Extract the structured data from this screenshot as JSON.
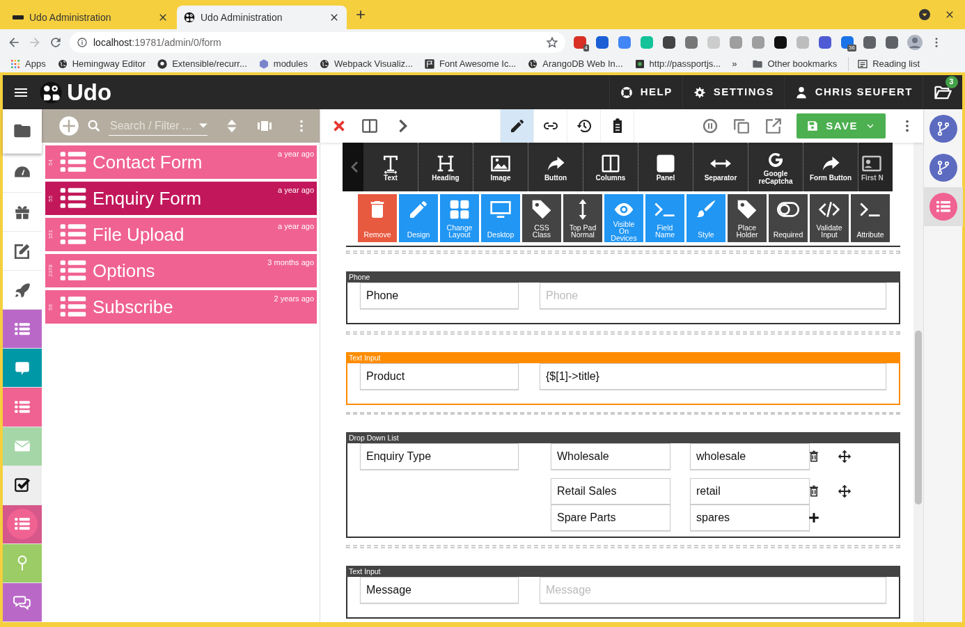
{
  "browser": {
    "tabs": [
      {
        "title": "Udo Administration",
        "selected": false
      },
      {
        "title": "Udo Administration",
        "selected": true
      }
    ],
    "address": {
      "host": "localhost",
      "path": ":19781/admin/0/form"
    },
    "extensions": [
      {
        "color": "#d93025",
        "badge": "4"
      },
      {
        "color": "#1a5fd6"
      },
      {
        "color": "#4285f4"
      },
      {
        "color": "#15c39a"
      },
      {
        "color": "#444444"
      },
      {
        "color": "#777777"
      },
      {
        "color": "#cccccc"
      },
      {
        "color": "#9e9e9e"
      },
      {
        "color": "#9e9e9e"
      },
      {
        "color": "#111111"
      },
      {
        "color": "#bdbdbd"
      },
      {
        "color": "#4f5bd5"
      },
      {
        "color": "#1a73e8",
        "badge": "36"
      },
      {
        "color": "#5f6368"
      },
      {
        "color": "#5f6368"
      }
    ],
    "bookmarks": [
      {
        "label": "Apps"
      },
      {
        "label": "Hemingway Editor"
      },
      {
        "label": "Extensible/recurr..."
      },
      {
        "label": "modules"
      },
      {
        "label": "Webpack Visualiz..."
      },
      {
        "label": "Font Awesome Ic..."
      },
      {
        "label": "ArangoDB Web In..."
      },
      {
        "label": "http://passportjs..."
      }
    ],
    "more": "»",
    "other_bookmarks": "Other bookmarks",
    "reading_list": "Reading list"
  },
  "app": {
    "brand": "Udo",
    "nav": [
      {
        "label": "HELP"
      },
      {
        "label": "SETTINGS"
      },
      {
        "label": "CHRIS SEUFERT"
      }
    ],
    "notification_count": "3"
  },
  "rail": [
    {
      "color": "#ffffff",
      "selected": true
    },
    {
      "color": "#ffffff",
      "selected": false
    },
    {
      "color": "#ffffff",
      "selected": false
    },
    {
      "color": "#ffffff",
      "selected": false
    },
    {
      "color": "#ffffff",
      "selected": false
    },
    {
      "color": "#ba68c8",
      "selected": false
    },
    {
      "color": "#0097a7",
      "selected": false
    },
    {
      "color": "#f06292",
      "selected": false
    },
    {
      "color": "#a5d6a7",
      "selected": false
    },
    {
      "color": "#eeeeee",
      "selected": false
    },
    {
      "color": "#d6578a",
      "selected": false
    },
    {
      "color": "#9ccc65",
      "selected": false
    },
    {
      "color": "#ba68c8",
      "selected": false
    }
  ],
  "panel": {
    "search_placeholder": "Search / Filter ...",
    "items": [
      {
        "id": "54",
        "title": "Contact Form",
        "time": "a year ago",
        "selected": false
      },
      {
        "id": "55",
        "title": "Enquiry Form",
        "time": "a year ago",
        "selected": true
      },
      {
        "id": "151",
        "title": "File Upload",
        "time": "a year ago",
        "selected": false
      },
      {
        "id": "2378",
        "title": "Options",
        "time": "3 months ago",
        "selected": false
      },
      {
        "id": "56",
        "title": "Subscribe",
        "time": "2 years ago",
        "selected": false
      }
    ]
  },
  "toolbar": {
    "modes": [
      {
        "selected": true
      },
      {
        "selected": false
      },
      {
        "selected": false
      },
      {
        "selected": false
      }
    ],
    "save": "SAVE"
  },
  "palette": [
    {
      "label": "Text"
    },
    {
      "label": "Heading"
    },
    {
      "label": "Image"
    },
    {
      "label": "Button"
    },
    {
      "label": "Columns"
    },
    {
      "label": "Panel"
    },
    {
      "label": "Separator"
    },
    {
      "label": "Google reCaptcha"
    },
    {
      "label": "Form Button"
    },
    {
      "label": "First N"
    }
  ],
  "properties": [
    {
      "label": "Remove",
      "kind": "danger"
    },
    {
      "label": "Design",
      "kind": "active"
    },
    {
      "label": "Change Layout",
      "kind": "active"
    },
    {
      "label": "Desktop",
      "kind": "active"
    },
    {
      "label": "CSS Class",
      "kind": "plain"
    },
    {
      "label": "Top Pad Normal",
      "kind": "plain"
    },
    {
      "label": "Visible On Devices",
      "kind": "active"
    },
    {
      "label": "Field Name",
      "kind": "active"
    },
    {
      "label": "Style",
      "kind": "active"
    },
    {
      "label": "Place Holder",
      "kind": "plain"
    },
    {
      "label": "Required",
      "kind": "plain"
    },
    {
      "label": "Validate Input",
      "kind": "plain"
    },
    {
      "label": "Attribute",
      "kind": "plain"
    }
  ],
  "form": {
    "blocks": [
      {
        "kind": "input",
        "type": "Phone",
        "selected": false,
        "label": "Phone",
        "placeholder": "Phone"
      },
      {
        "kind": "input",
        "type": "Text Input",
        "selected": true,
        "label": "Product",
        "value": "{$[1]->title}"
      },
      {
        "kind": "dropdown",
        "type": "Drop Down List",
        "selected": false,
        "label": "Enquiry Type",
        "options": [
          {
            "kind": "item",
            "label": "Wholesale",
            "value": "wholesale"
          },
          {
            "kind": "item",
            "label": "Retail Sales",
            "value": "retail"
          },
          {
            "kind": "new",
            "label": "Spare Parts",
            "value": "spares"
          }
        ]
      },
      {
        "kind": "input",
        "type": "Text Input",
        "selected": false,
        "label": "Message",
        "placeholder": "Message"
      }
    ]
  }
}
